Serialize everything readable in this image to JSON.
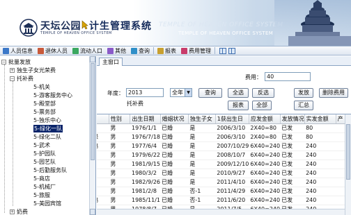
{
  "banner": {
    "brand": "天坛公园",
    "brand_sub": "TEMPLE OF HEAVEN OFFICE SYSTEM",
    "system_title": "计生管理系统",
    "watermark_1": "TEMPLE OF HEAVEN OFFICE SYSTEM",
    "watermark_2": "TEMPLE OF HEAVEN OFFICE SYSTEM"
  },
  "menu": {
    "items": [
      {
        "label": "人员信息",
        "icon": "people-icon"
      },
      {
        "label": "退休人员",
        "icon": "retiree-icon"
      },
      {
        "label": "流动人口",
        "icon": "migrant-icon"
      },
      {
        "label": "其他",
        "icon": "other-icon"
      },
      {
        "label": "查询",
        "icon": "query-icon"
      },
      {
        "label": "报表",
        "icon": "report-icon"
      },
      {
        "label": "费用管理",
        "icon": "fee-icon"
      }
    ]
  },
  "tree": {
    "root": "批量发放",
    "items": [
      {
        "label": "独生子女光荣费",
        "level": 1,
        "expander": "+"
      },
      {
        "label": "托补费",
        "level": 1,
        "expander": "-"
      },
      {
        "label": "5-机关",
        "level": 2
      },
      {
        "label": "5-游客服务中心",
        "level": 2
      },
      {
        "label": "5-殿堂部",
        "level": 2
      },
      {
        "label": "5-票务部",
        "level": 2
      },
      {
        "label": "5-独乐中心",
        "level": 2
      },
      {
        "label": "5-绿化一队",
        "level": 2,
        "selected": true
      },
      {
        "label": "5-绿化二队",
        "level": 2
      },
      {
        "label": "5-武术",
        "level": 2
      },
      {
        "label": "5-护园队",
        "level": 2
      },
      {
        "label": "5-园艺队",
        "level": 2
      },
      {
        "label": "5-后勤服务队",
        "level": 2
      },
      {
        "label": "5-商店",
        "level": 2
      },
      {
        "label": "5-机械厂",
        "level": 2
      },
      {
        "label": "5-旅服",
        "level": 2
      },
      {
        "label": "5-美园宾馆",
        "level": 2
      },
      {
        "label": "奶费",
        "level": 1,
        "expander": "+"
      }
    ]
  },
  "tab": {
    "label": "主窗口"
  },
  "form": {
    "fee_label": "费用：",
    "fee_value": "40",
    "year_label": "年度：",
    "year_value": "2013",
    "scope_value": "全年",
    "subtitle": "托补费"
  },
  "buttons": {
    "query": "查询",
    "select_all": "全选",
    "invert": "反选",
    "issue": "发放",
    "delete_fee": "删除费用",
    "report": "报表",
    "all": "全部",
    "summary": "汇总"
  },
  "table": {
    "columns": [
      "",
      "性别",
      "出生日期",
      "婚姻状况",
      "独生子女",
      "1获出生日",
      "应发金额",
      "发放情况",
      "实发金额",
      "产"
    ],
    "rows": [
      [
        "",
        "男",
        "1976/1/1",
        "已婚",
        "是",
        "2006/3/10",
        "2X40=80",
        "已发",
        "80",
        ""
      ],
      [
        "禄",
        "男",
        "1976/7/18",
        "已婚",
        "是",
        "2006/3/10",
        "2X40=80",
        "已发",
        "80",
        ""
      ],
      [
        "鹏",
        "男",
        "1977/6/4",
        "已婚",
        "是",
        "2007/10/29",
        "6X40=240",
        "已发",
        "240",
        ""
      ],
      [
        "",
        "男",
        "1979/6/22",
        "已婚",
        "是",
        "2008/10/7",
        "6X40=240",
        "已发",
        "240",
        ""
      ],
      [
        "",
        "男",
        "1981/9/15",
        "已婚",
        "是",
        "2009/12/10",
        "6X40=240",
        "已发",
        "240",
        ""
      ],
      [
        "",
        "男",
        "1980/3/2",
        "已婚",
        "是",
        "2010/9/27",
        "6X40=240",
        "已发",
        "240",
        ""
      ],
      [
        "",
        "男",
        "1982/9/26",
        "已婚",
        "是",
        "2011/4/10",
        "6X40=240",
        "已发",
        "240",
        ""
      ],
      [
        "",
        "男",
        "1981/2/8",
        "已婚",
        "否-1",
        "2011/4/29",
        "6X40=240",
        "已发",
        "240",
        ""
      ],
      [
        "鹏",
        "男",
        "1985/11/1",
        "已婚",
        "否-1",
        "2011/6/20",
        "6X40=240",
        "已发",
        "240",
        ""
      ],
      [
        "",
        "男",
        "1978/8/7",
        "已婚",
        "是",
        "2011/7/5",
        "6X40=240",
        "已发",
        "240",
        ""
      ]
    ]
  }
}
